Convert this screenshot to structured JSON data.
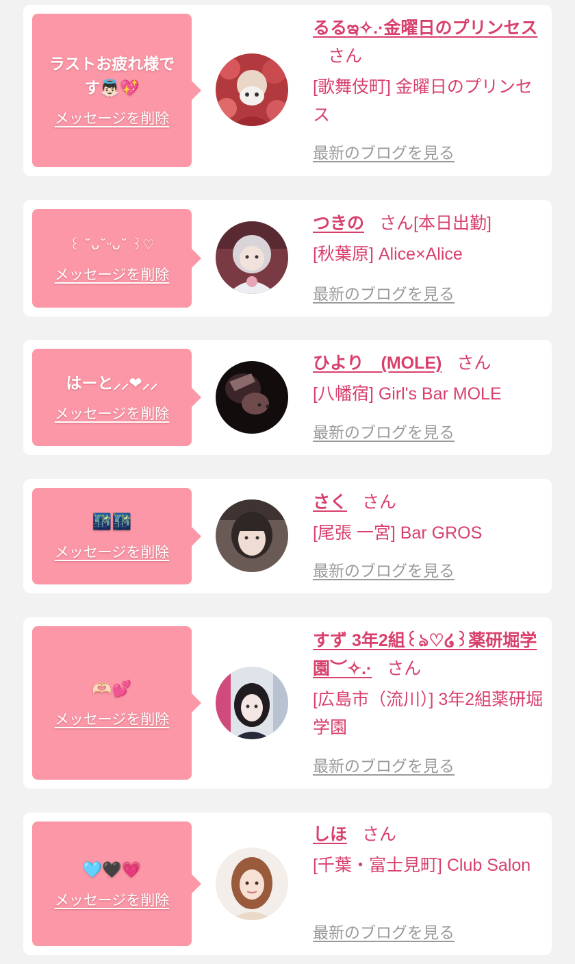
{
  "items": [
    {
      "message": "ラストお疲れ様です👼🏻💖",
      "delete_label": "メッセージを削除",
      "name": "るるఇ✧.·金曜日のプリンセス",
      "honorific": "さん",
      "status": "",
      "shop": "[歌舞伎町] 金曜日のプリンセス",
      "blog_label": "最新のブログを見る"
    },
    {
      "message": "꒰ ˘ᴗ˘ᵕᴗ˘ ꒱♡",
      "delete_label": "メッセージを削除",
      "name": "つきの",
      "honorific": "さん",
      "status": "[本日出勤]",
      "shop": "[秋葉原] Alice×Alice",
      "blog_label": "最新のブログを見る"
    },
    {
      "message": "はーと⸝⸝❤︎⸝⸝",
      "delete_label": "メッセージを削除",
      "name": "ひより　(MOLE)",
      "honorific": "さん",
      "status": "",
      "shop": "[八幡宿] Girl's Bar MOLE",
      "blog_label": "最新のブログを見る"
    },
    {
      "message": "🌃🌃",
      "delete_label": "メッセージを削除",
      "name": "さく",
      "honorific": "さん",
      "status": "",
      "shop": "[尾張 一宮] Bar GROS",
      "blog_label": "最新のブログを見る"
    },
    {
      "message": "🫶🏻💕",
      "delete_label": "メッセージを削除",
      "name": "すず 3年2組꒰ঌ♡໒꒱薬研堀学園︶✧.·",
      "honorific": "さん",
      "status": "",
      "shop": "[広島市（流川）] 3年2組薬研堀学園",
      "blog_label": "最新のブログを見る"
    },
    {
      "message": "🩵🖤💗",
      "delete_label": "メッセージを削除",
      "name": "しほ",
      "honorific": "さん",
      "status": "",
      "shop": "[千葉・富士見町] Club Salon",
      "blog_label": "最新のブログを見る"
    }
  ],
  "colors": {
    "page_background": "#f2f2f2",
    "card_background": "#ffffff",
    "bubble": "#fb97a6",
    "accent_text": "#d8406c",
    "muted_link": "#9a9a9a"
  }
}
